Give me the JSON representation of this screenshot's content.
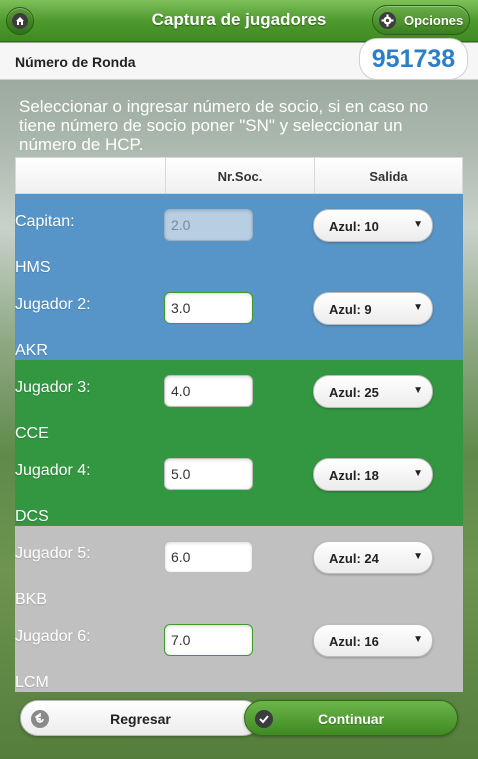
{
  "header": {
    "title": "Captura de jugadores",
    "home_icon": "home-icon",
    "options_label": "Opciones",
    "options_icon": "gear-icon"
  },
  "ronda": {
    "label": "Número de Ronda",
    "value": "951738"
  },
  "instructions": "Seleccionar o ingresar número de socio, si en caso no tiene número de socio poner \"SN\" y seleccionar un número de HCP.",
  "table": {
    "headers": [
      "",
      "Nr.Soc.",
      "Salida"
    ],
    "players": [
      {
        "name": "Capitan:",
        "code": "HMS",
        "number": "2.0",
        "salida": "Azul: 10"
      },
      {
        "name": "Jugador 2:",
        "code": "AKR",
        "number": "3.0",
        "salida": "Azul: 9"
      },
      {
        "name": "Jugador 3:",
        "code": "CCE",
        "number": "4.0",
        "salida": "Azul: 25"
      },
      {
        "name": "Jugador 4:",
        "code": "DCS",
        "number": "5.0",
        "salida": "Azul: 18"
      },
      {
        "name": "Jugador 5:",
        "code": "BKB",
        "number": "6.0",
        "salida": "Azul: 24"
      },
      {
        "name": "Jugador 6:",
        "code": "LCM",
        "number": "7.0",
        "salida": "Azul: 16"
      }
    ]
  },
  "footer": {
    "back_label": "Regresar",
    "continue_label": "Continuar"
  },
  "colors": {
    "header_green": "#4f9a2e",
    "team_blue": "#5795c8",
    "team_green": "#339641",
    "team_gray": "#c0c0c0",
    "ronda_blue": "#2a7fc8"
  }
}
